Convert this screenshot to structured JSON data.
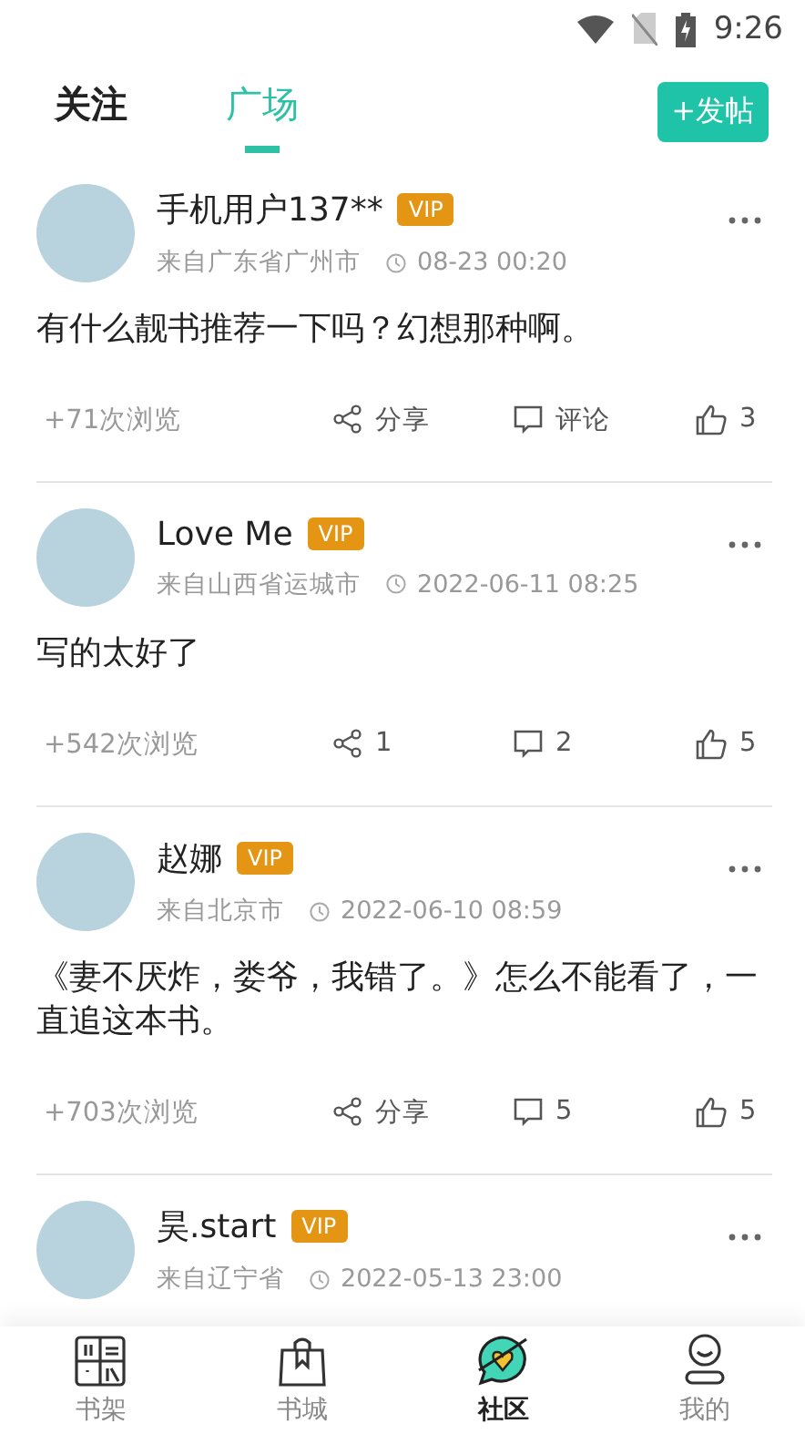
{
  "status_bar": {
    "time": "9:26"
  },
  "tabs": [
    {
      "label": "关注",
      "selected": false
    },
    {
      "label": "广场",
      "selected": true
    }
  ],
  "post_button": "+发帖",
  "posts": [
    {
      "author": "手机用户137**",
      "badge": "VIP",
      "location": "来自广东省广州市",
      "time": "08-23 00:20",
      "content": "有什么靓书推荐一下吗？幻想那种啊。",
      "views": "+71次浏览",
      "share": "分享",
      "comment": "评论",
      "like": "3"
    },
    {
      "author": "Love Me",
      "badge": "VIP",
      "location": "来自山西省运城市",
      "time": "2022-06-11 08:25",
      "content": "写的太好了",
      "views": "+542次浏览",
      "share": "1",
      "comment": "2",
      "like": "5"
    },
    {
      "author": "赵娜",
      "badge": "VIP",
      "location": "来自北京市",
      "time": "2022-06-10 08:59",
      "content": "《妻不厌炸，娄爷，我错了。》怎么不能看了，一直追这本书。",
      "views": "+703次浏览",
      "share": "分享",
      "comment": "5",
      "like": "5"
    },
    {
      "author": "昊.start",
      "badge": "VIP",
      "location": "来自辽宁省",
      "time": "2022-05-13 23:00"
    }
  ],
  "nav": [
    {
      "kind": "shelf",
      "label": "书架",
      "selected": false
    },
    {
      "kind": "store",
      "label": "书城",
      "selected": false
    },
    {
      "kind": "community",
      "label": "社区",
      "selected": true
    },
    {
      "kind": "profile",
      "label": "我的",
      "selected": false
    }
  ]
}
